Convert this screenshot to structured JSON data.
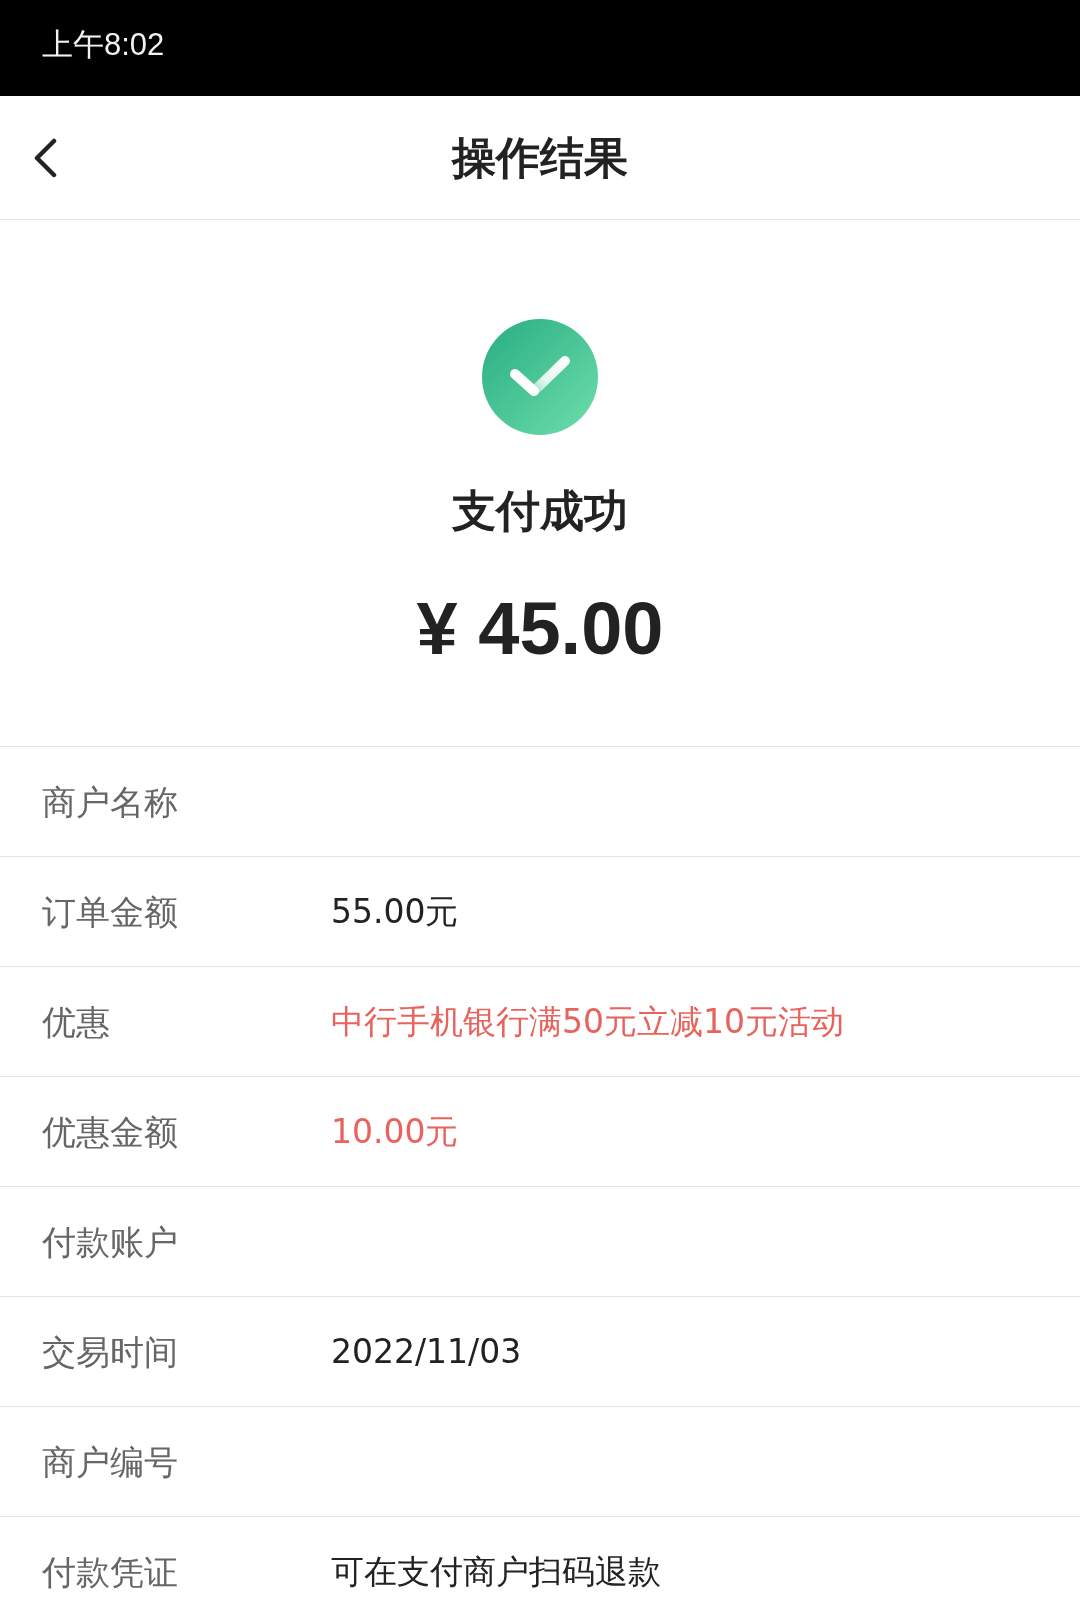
{
  "status_bar": {
    "time": "上午8:02"
  },
  "header": {
    "title": "操作结果"
  },
  "result": {
    "status": "支付成功",
    "amount": "¥ 45.00"
  },
  "details": [
    {
      "label": "商户名称"
    },
    {
      "label": "订单金额",
      "value": "55.00元",
      "highlighted": false
    },
    {
      "label": "优惠",
      "value": "中行手机银行满50元立减10元活动",
      "highlighted": true
    },
    {
      "label": "优惠金额",
      "value": "10.00元",
      "highlighted": true
    },
    {
      "label": "付款账户"
    },
    {
      "label": "交易时间",
      "value": "2022/11/03",
      "highlighted": false
    },
    {
      "label": "商户编号"
    },
    {
      "label": "付款凭证",
      "value": "可在支付商户扫码退款",
      "highlighted": false
    }
  ]
}
